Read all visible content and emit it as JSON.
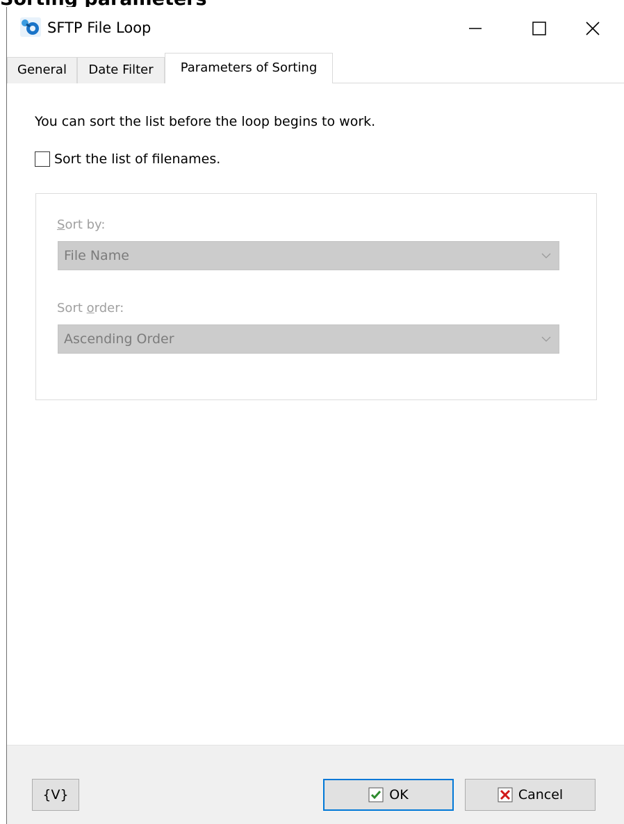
{
  "page_heading": "Sorting parameters",
  "window": {
    "title": "SFTP File Loop",
    "icon": "gear-link-icon",
    "controls": [
      "minimize-icon",
      "maximize-icon",
      "close-icon"
    ]
  },
  "tabs": [
    {
      "label": "General",
      "active": false
    },
    {
      "label": "Date Filter",
      "active": false
    },
    {
      "label": "Parameters of Sorting",
      "active": true
    }
  ],
  "content": {
    "intro": "You can sort the list before the loop begins to work.",
    "sort_checkbox": {
      "label": "Sort the list of filenames.",
      "checked": false
    },
    "sort_by": {
      "label": "Sort by:",
      "value": "File Name",
      "enabled": false
    },
    "sort_order": {
      "label": "Sort order:",
      "value": "Ascending Order",
      "enabled": false
    }
  },
  "footer": {
    "variables_button": "{V}",
    "ok_button": "OK",
    "cancel_button": "Cancel"
  },
  "colors": {
    "default_button_border": "#0078d7",
    "ok_check": "#2e8b2e",
    "cancel_x": "#d11a1a",
    "disabled_combo_bg": "#cccccc"
  }
}
